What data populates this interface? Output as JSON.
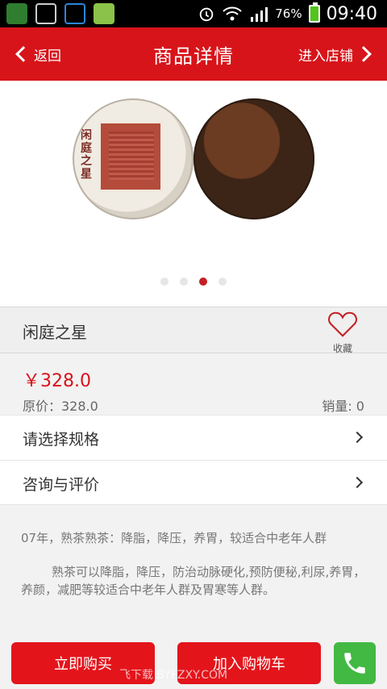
{
  "statusbar": {
    "battery_percent": "76%",
    "time": "09:40"
  },
  "topbar": {
    "back_label": "返回",
    "title": "商品详情",
    "shop_label": "进入店铺"
  },
  "product": {
    "name": "闲庭之星",
    "cake_text": "闲庭之星",
    "carousel": {
      "total": 4,
      "active_index": 2
    },
    "favorite_label": "收藏",
    "price": "￥328.0",
    "original_price": "原价：328.0",
    "sales": "销量:  0"
  },
  "rows": [
    {
      "label": "请选择规格"
    },
    {
      "label": "咨询与评价"
    }
  ],
  "description": {
    "p1": "07年，熟茶熟茶：降脂，降压，养胃，较适合中老年人群",
    "p2": "熟茶可以降脂，降压，防治动脉硬化,预防便秘,利尿,养胃，养颜，减肥等较适合中老年人群及胃寒等人群。"
  },
  "bottom": {
    "buy_label": "立即购买",
    "cart_label": "加入购物车",
    "watermark": "飞下载 BYFZXY.COM"
  },
  "colors": {
    "brand_red": "#d7141a",
    "phone_green": "#42b943",
    "active_dot": "#c42025"
  },
  "icons": [
    "back-chevron-icon",
    "forward-chevron-icon",
    "heart-icon",
    "phone-icon",
    "wifi-icon",
    "signal-icon",
    "battery-icon",
    "alarm-icon"
  ]
}
